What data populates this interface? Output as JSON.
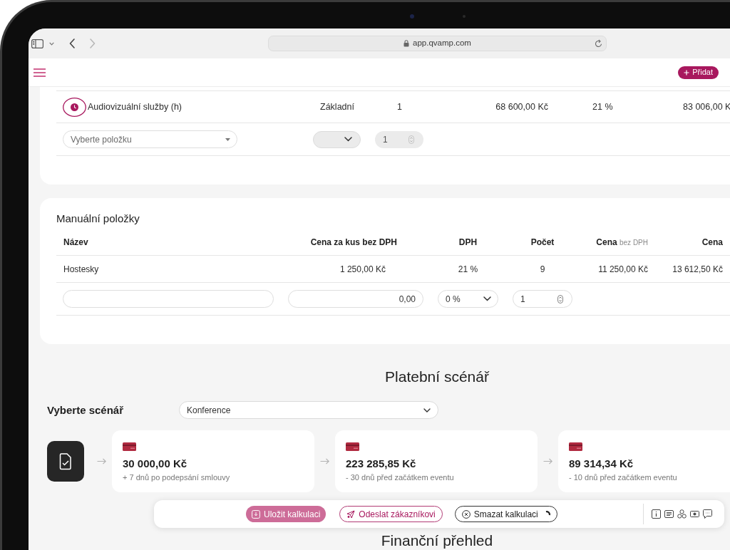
{
  "browser": {
    "url": "app.qvamp.com",
    "can_go_forward": false
  },
  "header": {
    "add_button": "Přidat"
  },
  "services_table": {
    "rows": [
      {
        "cells": [
          "Audiovizuální služby (h)",
          "Základní",
          "1",
          "68 600,00 Kč",
          "21 %",
          "83 006,00 K"
        ]
      }
    ],
    "new_row": {
      "item_placeholder": "Vyberte položku",
      "quantity": "1"
    }
  },
  "manual_items": {
    "title": "Manuální položky",
    "columns": [
      {
        "label": "Název"
      },
      {
        "label": "Cena za kus bez DPH"
      },
      {
        "label": "DPH"
      },
      {
        "label": "Počet"
      },
      {
        "label": "Cena",
        "suffix": "bez DPH"
      },
      {
        "label": "Cena"
      }
    ],
    "rows": [
      {
        "cells": [
          "Hostesky",
          "1 250,00 Kč",
          "21 %",
          "9",
          "11 250,00 Kč",
          "13 612,50 Kč"
        ]
      }
    ],
    "new_row": {
      "price": "0,00",
      "vat": "0 %",
      "count": "1"
    }
  },
  "payment_scenario": {
    "title": "Platební scénář",
    "select_label": "Vyberte scénář",
    "selected_scenario": "Konference",
    "steps": [
      {
        "amount": "30 000,00 Kč",
        "due": "+ 7 dnů po podepsání smlouvy"
      },
      {
        "amount": "223 285,85 Kč",
        "due": "- 30 dnů před začátkem eventu"
      },
      {
        "amount": "89 314,34 Kč",
        "due": "- 10 dnů před začátkem eventu"
      }
    ]
  },
  "financial_overview": {
    "title": "Finanční přehled"
  },
  "action_bar": {
    "buttons": [
      {
        "kind": "primary",
        "label": "Uložit kalkulaci",
        "busy": false
      },
      {
        "kind": "outline",
        "label": "Odeslat zákazníkovi",
        "busy": false
      },
      {
        "kind": "neutral",
        "label": "Smazat kalkulaci",
        "busy": true
      }
    ]
  }
}
